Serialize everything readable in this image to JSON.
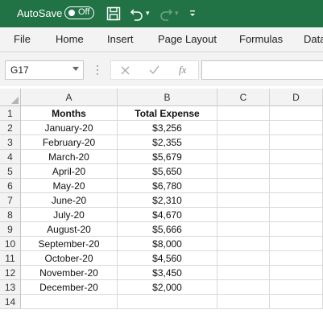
{
  "titlebar": {
    "autosave_label": "AutoSave",
    "autosave_state": "Off",
    "bg_color": "#217346"
  },
  "ribbon": {
    "tabs": [
      "File",
      "Home",
      "Insert",
      "Page Layout",
      "Formulas",
      "Data"
    ]
  },
  "formula_bar": {
    "name_box": "G17",
    "formula": ""
  },
  "sheet": {
    "columns": [
      "A",
      "B",
      "C",
      "D"
    ],
    "rows": [
      "1",
      "2",
      "3",
      "4",
      "5",
      "6",
      "7",
      "8",
      "9",
      "10",
      "11",
      "12",
      "13",
      "14"
    ],
    "header": {
      "months": "Months",
      "total_expense": "Total Expense"
    },
    "data": [
      {
        "month": "January-20",
        "expense": "$3,256"
      },
      {
        "month": "February-20",
        "expense": "$2,355"
      },
      {
        "month": "March-20",
        "expense": "$5,679"
      },
      {
        "month": "April-20",
        "expense": "$5,650"
      },
      {
        "month": "May-20",
        "expense": "$6,780"
      },
      {
        "month": "June-20",
        "expense": "$2,310"
      },
      {
        "month": "July-20",
        "expense": "$4,670"
      },
      {
        "month": "August-20",
        "expense": "$5,666"
      },
      {
        "month": "September-20",
        "expense": "$8,000"
      },
      {
        "month": "October-20",
        "expense": "$4,560"
      },
      {
        "month": "November-20",
        "expense": "$3,450"
      },
      {
        "month": "December-20",
        "expense": "$2,000"
      }
    ]
  }
}
